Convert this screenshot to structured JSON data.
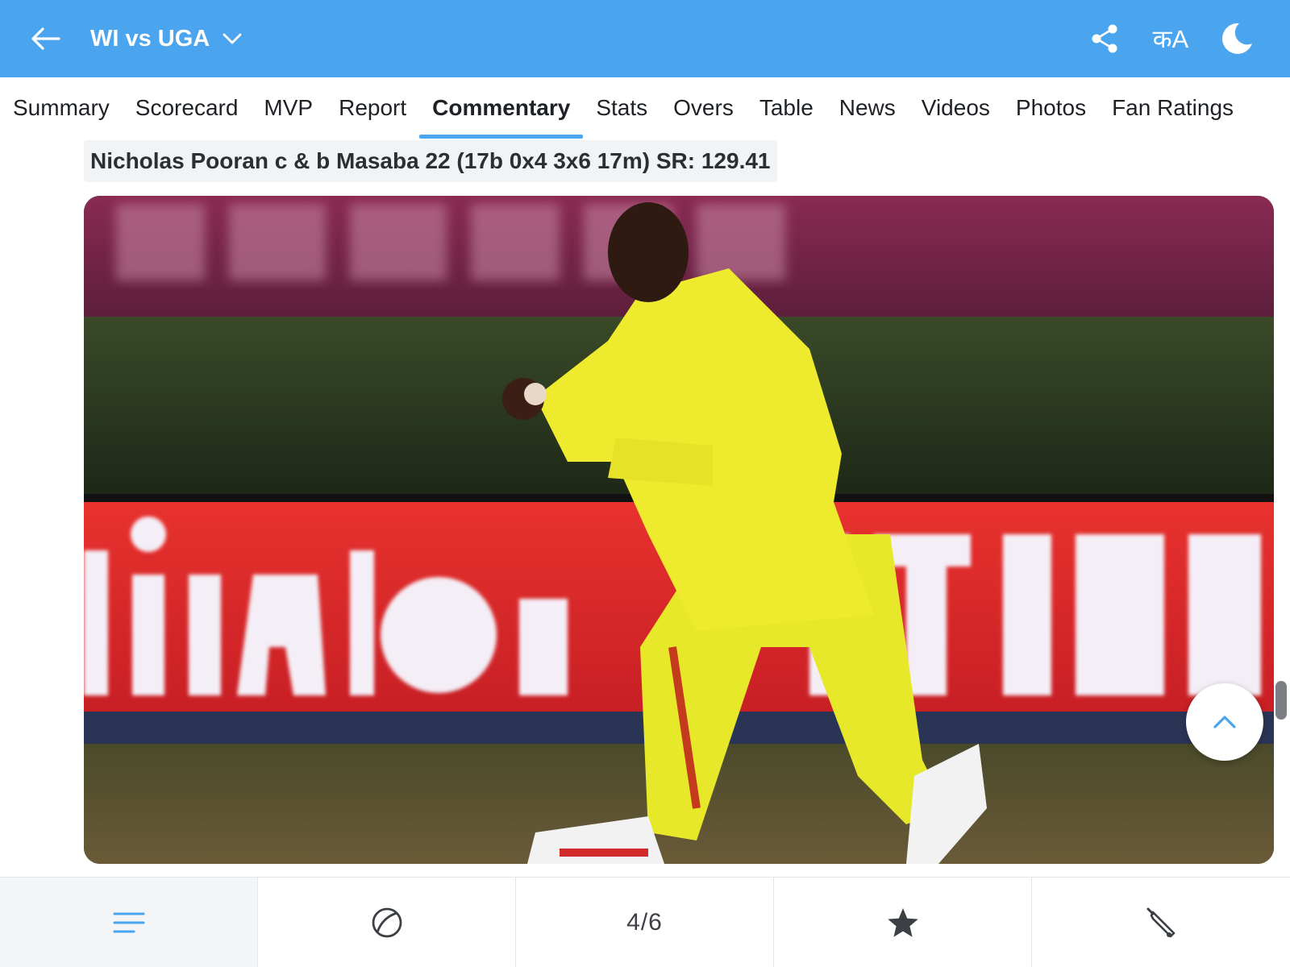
{
  "header": {
    "match_title": "WI vs UGA",
    "lang_label": "कA",
    "icons": {
      "back": "arrow-left-icon",
      "dropdown": "chevron-down-icon",
      "share": "share-icon",
      "theme": "moon-icon"
    }
  },
  "tabs": [
    {
      "label": "Summary",
      "active": false
    },
    {
      "label": "Scorecard",
      "active": false
    },
    {
      "label": "MVP",
      "active": false
    },
    {
      "label": "Report",
      "active": false
    },
    {
      "label": "Commentary",
      "active": true
    },
    {
      "label": "Stats",
      "active": false
    },
    {
      "label": "Overs",
      "active": false
    },
    {
      "label": "Table",
      "active": false
    },
    {
      "label": "News",
      "active": false
    },
    {
      "label": "Videos",
      "active": false
    },
    {
      "label": "Photos",
      "active": false
    },
    {
      "label": "Fan Ratings",
      "active": false
    }
  ],
  "commentary": {
    "dismissal_text": "Nicholas Pooran c & b Masaba 22 (17b 0x4 3x6 17m) SR: 129.41"
  },
  "photo": {
    "icon": "photo-image"
  },
  "bottom_nav": {
    "items": [
      {
        "icon": "menu-lines-icon",
        "label": ""
      },
      {
        "icon": "cricket-ball-icon",
        "label": ""
      },
      {
        "icon": "",
        "label": "4/6"
      },
      {
        "icon": "star-icon",
        "label": ""
      },
      {
        "icon": "cricket-bat-icon",
        "label": ""
      }
    ]
  },
  "colors": {
    "header_bg": "#4aa5ee",
    "accent": "#4aa5ee",
    "text": "#1e2226"
  }
}
